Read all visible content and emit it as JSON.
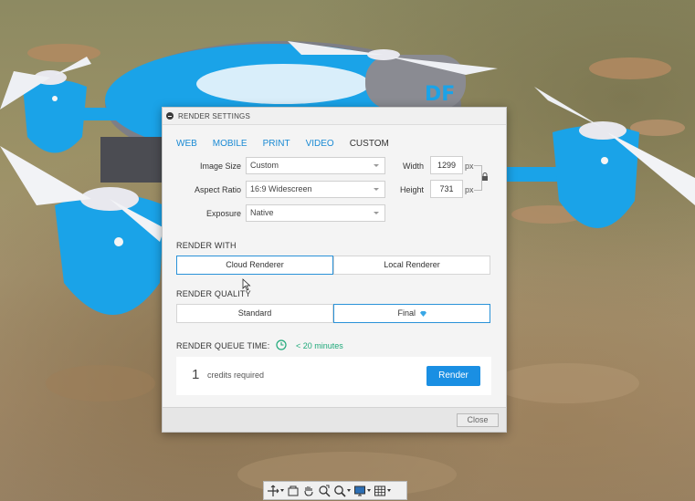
{
  "dialog": {
    "title": "RENDER SETTINGS",
    "tabs": [
      {
        "label": "WEB"
      },
      {
        "label": "MOBILE"
      },
      {
        "label": "PRINT"
      },
      {
        "label": "VIDEO"
      },
      {
        "label": "CUSTOM",
        "active": true
      }
    ],
    "image_size": {
      "label": "Image Size",
      "value": "Custom"
    },
    "aspect_ratio": {
      "label": "Aspect Ratio",
      "value": "16:9 Widescreen"
    },
    "exposure": {
      "label": "Exposure",
      "value": "Native"
    },
    "width": {
      "label": "Width",
      "value": "1299",
      "unit": "px"
    },
    "height": {
      "label": "Height",
      "value": "731",
      "unit": "px"
    },
    "render_with": {
      "label": "RENDER WITH",
      "options": [
        "Cloud Renderer",
        "Local Renderer"
      ],
      "selected": "Cloud Renderer"
    },
    "render_quality": {
      "label": "RENDER QUALITY",
      "options": [
        "Standard",
        "Final"
      ],
      "selected": "Final"
    },
    "queue": {
      "label": "RENDER QUEUE TIME:",
      "value": "< 20 minutes"
    },
    "credits": {
      "count": "1",
      "text": "credits required"
    },
    "render_button": "Render",
    "close_button": "Close"
  },
  "colors": {
    "accent": "#1a8fe3",
    "tab_link": "#1a8ad4",
    "queue_green": "#1fa97a",
    "drone_blue": "#1aa3e8"
  },
  "toolbar_icons": [
    "orbit-icon",
    "pan-box-icon",
    "hand-icon",
    "zoom-window-icon",
    "zoom-icon",
    "display-icon",
    "grid-icon"
  ]
}
